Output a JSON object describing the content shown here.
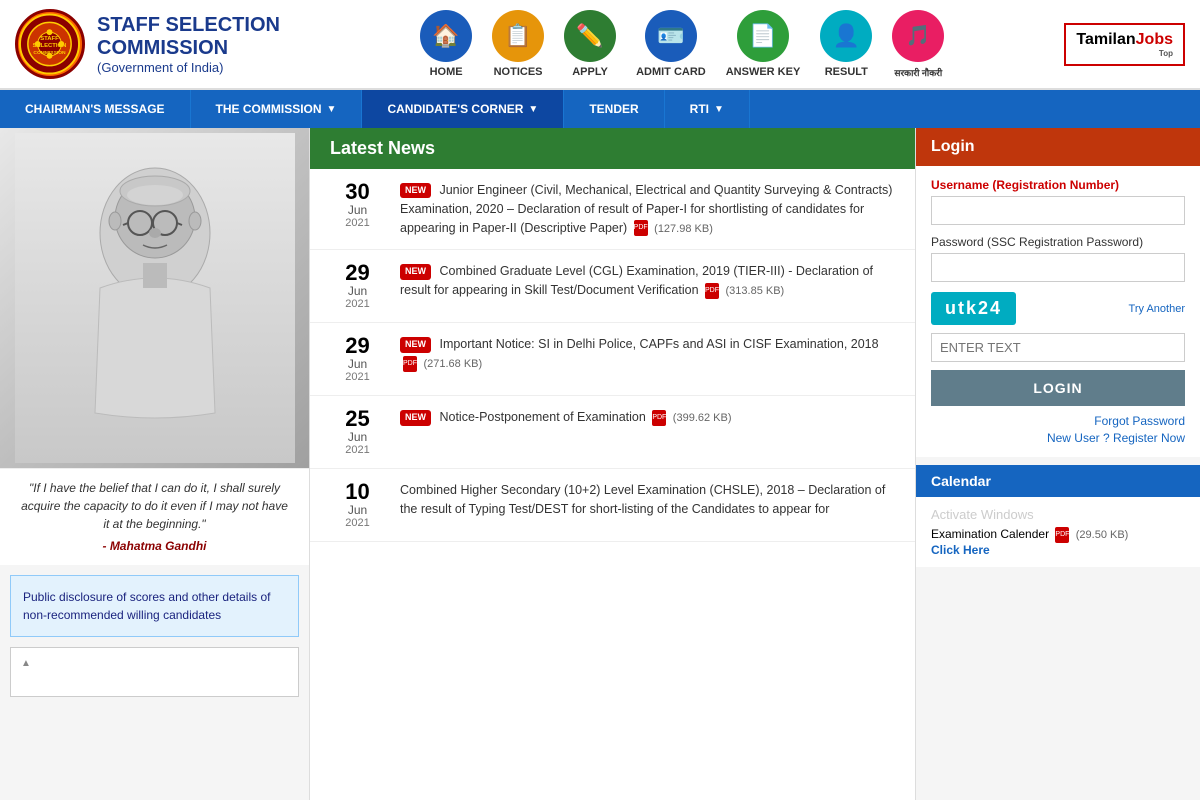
{
  "header": {
    "logo_text": "SSC",
    "org_name": "STAFF SELECTION COMMISSION",
    "org_subtitle": "(Government of India)",
    "tamilan_label": "Tamilan",
    "jobs_label": "Jobs",
    "tamilan_top": "Top"
  },
  "nav_icons": [
    {
      "label": "HOME",
      "icon": "🏠",
      "class": "home-icon"
    },
    {
      "label": "NOTICES",
      "icon": "📋",
      "class": "notices-icon"
    },
    {
      "label": "APPLY",
      "icon": "✏️",
      "class": "apply-icon"
    },
    {
      "label": "ADMIT CARD",
      "icon": "🪪",
      "class": "admit-icon"
    },
    {
      "label": "ANSWER KEY",
      "icon": "📄",
      "class": "answer-icon"
    },
    {
      "label": "RESULT",
      "icon": "👤",
      "class": "result-icon"
    }
  ],
  "navbar": {
    "items": [
      {
        "label": "CHAIRMAN'S MESSAGE",
        "has_arrow": false
      },
      {
        "label": "THE COMMISSION",
        "has_arrow": true
      },
      {
        "label": "CANDIDATE'S CORNER",
        "has_arrow": true
      },
      {
        "label": "TENDER",
        "has_arrow": false
      },
      {
        "label": "RTI",
        "has_arrow": true
      }
    ]
  },
  "sidebar": {
    "quote": "\"If I have the belief that I can do it, I shall surely acquire the capacity to do it even if I may not have it at the beginning.\"",
    "author": "- Mahatma Gandhi",
    "info_box_text": "Public disclosure of scores and other details of non-recommended willing candidates"
  },
  "latest_news": {
    "title": "Latest News",
    "items": [
      {
        "day": "30",
        "month": "Jun",
        "year": "2021",
        "is_new": true,
        "text": "Junior Engineer (Civil, Mechanical, Electrical and Quantity Surveying & Contracts) Examination, 2020 – Declaration of result of Paper-I for shortlisting of candidates for appearing in Paper-II (Descriptive Paper)",
        "file_size": "(127.98 KB)"
      },
      {
        "day": "29",
        "month": "Jun",
        "year": "2021",
        "is_new": true,
        "text": "Combined Graduate Level (CGL) Examination, 2019 (TIER-III) - Declaration of result for appearing in Skill Test/Document Verification",
        "file_size": "(313.85 KB)"
      },
      {
        "day": "29",
        "month": "Jun",
        "year": "2021",
        "is_new": true,
        "text": "Important Notice: SI in Delhi Police, CAPFs and ASI in CISF Examination, 2018",
        "file_size": "(271.68 KB)"
      },
      {
        "day": "25",
        "month": "Jun",
        "year": "2021",
        "is_new": true,
        "text": "Notice-Postponement of Examination",
        "file_size": "(399.62 KB)"
      },
      {
        "day": "10",
        "month": "Jun",
        "year": "2021",
        "is_new": false,
        "text": "Combined Higher Secondary (10+2) Level Examination (CHSLE), 2018 – Declaration of the result of Typing Test/DEST for short-listing of the Candidates to appear for",
        "file_size": ""
      }
    ]
  },
  "login": {
    "title": "Login",
    "username_label": "Username (Registration Number)",
    "password_label": "Password (SSC Registration Password)",
    "captcha_text": "utk24",
    "try_another": "Try Another",
    "captcha_placeholder": "ENTER TEXT",
    "login_button": "LOGIN",
    "forgot_password": "Forgot Password",
    "new_user": "New User ? Register Now"
  },
  "calendar": {
    "title": "Calendar",
    "exam_calendar_text": "Examination Calender",
    "file_size": "(29.50 KB)",
    "click_here": "Click Here",
    "activate_text": "Activate Windows"
  }
}
